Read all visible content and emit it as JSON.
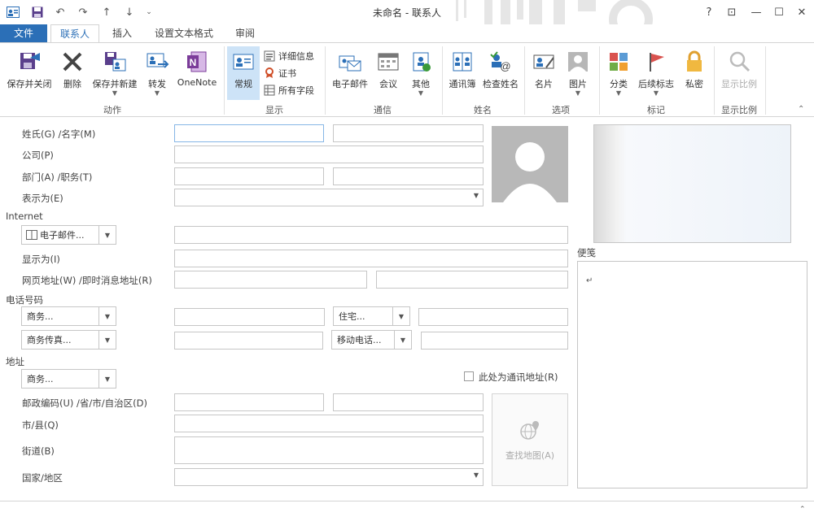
{
  "window": {
    "title": "未命名 - 联系人",
    "help": "?",
    "restore_ribbon": "⊡",
    "minimize": "—",
    "maximize": "☐",
    "close": "✕"
  },
  "tabs": [
    {
      "label": "文件"
    },
    {
      "label": "联系人"
    },
    {
      "label": "插入"
    },
    {
      "label": "设置文本格式"
    },
    {
      "label": "审阅"
    }
  ],
  "ribbon": {
    "groups": {
      "actions": "动作",
      "show": "显示",
      "communicate": "通信",
      "names": "姓名",
      "options": "选项",
      "tags": "标记",
      "zoom": "显示比例"
    },
    "buttons": {
      "save_close": "保存并关闭",
      "delete": "删除",
      "save_new": "保存并新建",
      "forward": "转发",
      "onenote": "OneNote",
      "general": "常规",
      "details": "详细信息",
      "certificates": "证书",
      "all_fields": "所有字段",
      "email": "电子邮件",
      "meeting": "会议",
      "more": "其他",
      "address_book": "通讯簿",
      "check_names": "检查姓名",
      "business_card": "名片",
      "picture": "图片",
      "categorize": "分类",
      "follow_up": "后续标志",
      "private": "私密",
      "zoom": "显示比例"
    }
  },
  "form": {
    "labels": {
      "full_name": "姓氏(G)  /名字(M)",
      "company": "公司(P)",
      "dept_title": "部门(A)  /职务(T)",
      "file_as": "表示为(E)",
      "internet_section": "Internet",
      "display_as": "显示为(I)",
      "web_im": "网页地址(W)  /即时消息地址(R)",
      "phone_section": "电话号码",
      "address_section": "地址",
      "postal": "邮政编码(U)  /省/市/自治区(D)",
      "city": "市/县(Q)",
      "street": "街道(B)",
      "country": "国家/地区",
      "notes": "便笺",
      "mailing_checkbox": "此处为通讯地址(R)",
      "map_button": "查找地图(A)"
    },
    "dropdowns": {
      "email": "电子邮件...",
      "phone_business": "商务...",
      "phone_home": "住宅...",
      "phone_business_fax": "商务传真...",
      "phone_mobile": "移动电话...",
      "address_type": "商务..."
    },
    "notes_text": "↵"
  }
}
